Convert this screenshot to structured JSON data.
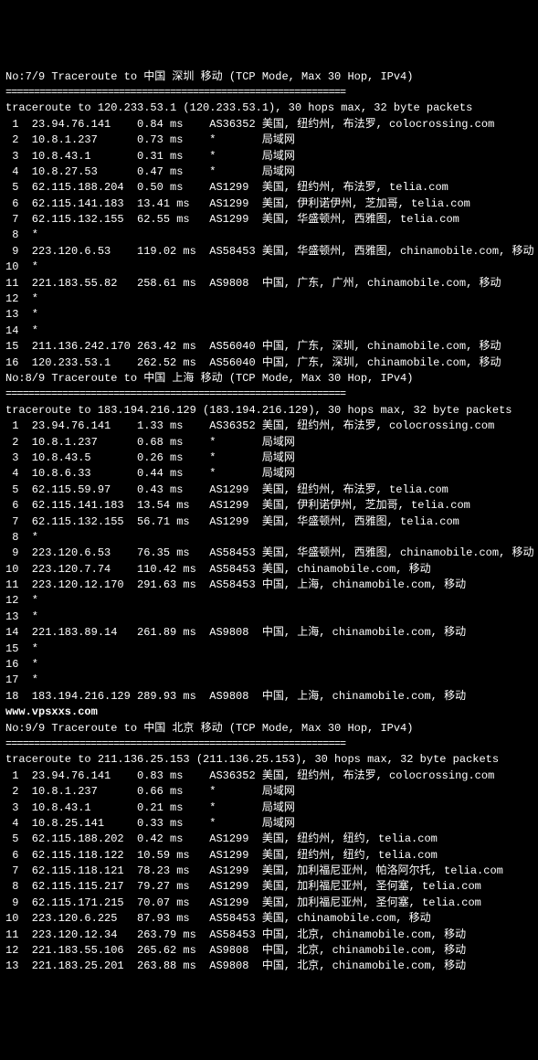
{
  "traces": [
    {
      "title": "No:7/9 Traceroute to 中国 深圳 移动 (TCP Mode, Max 30 Hop, IPv4)",
      "separator": "============================================================",
      "header": "traceroute to 120.233.53.1 (120.233.53.1), 30 hops max, 32 byte packets",
      "hops": [
        {
          "num": " 1",
          "ip": "23.94.76.141",
          "time": "0.84 ms",
          "asn": "AS36352",
          "loc": "美国, 纽约州, 布法罗, colocrossing.com"
        },
        {
          "num": " 2",
          "ip": "10.8.1.237",
          "time": "0.73 ms",
          "asn": "*",
          "loc": "局域网"
        },
        {
          "num": " 3",
          "ip": "10.8.43.1",
          "time": "0.31 ms",
          "asn": "*",
          "loc": "局域网"
        },
        {
          "num": " 4",
          "ip": "10.8.27.53",
          "time": "0.47 ms",
          "asn": "*",
          "loc": "局域网"
        },
        {
          "num": " 5",
          "ip": "62.115.188.204",
          "time": "0.50 ms",
          "asn": "AS1299",
          "loc": "美国, 纽约州, 布法罗, telia.com"
        },
        {
          "num": " 6",
          "ip": "62.115.141.183",
          "time": "13.41 ms",
          "asn": "AS1299",
          "loc": "美国, 伊利诺伊州, 芝加哥, telia.com"
        },
        {
          "num": " 7",
          "ip": "62.115.132.155",
          "time": "62.55 ms",
          "asn": "AS1299",
          "loc": "美国, 华盛顿州, 西雅图, telia.com"
        },
        {
          "num": " 8",
          "ip": "*",
          "time": "",
          "asn": "",
          "loc": ""
        },
        {
          "num": " 9",
          "ip": "223.120.6.53",
          "time": "119.02 ms",
          "asn": "AS58453",
          "loc": "美国, 华盛顿州, 西雅图, chinamobile.com, 移动"
        },
        {
          "num": "10",
          "ip": "*",
          "time": "",
          "asn": "",
          "loc": ""
        },
        {
          "num": "11",
          "ip": "221.183.55.82",
          "time": "258.61 ms",
          "asn": "AS9808",
          "loc": "中国, 广东, 广州, chinamobile.com, 移动"
        },
        {
          "num": "12",
          "ip": "*",
          "time": "",
          "asn": "",
          "loc": ""
        },
        {
          "num": "13",
          "ip": "*",
          "time": "",
          "asn": "",
          "loc": ""
        },
        {
          "num": "14",
          "ip": "*",
          "time": "",
          "asn": "",
          "loc": ""
        },
        {
          "num": "15",
          "ip": "211.136.242.170",
          "time": "263.42 ms",
          "asn": "AS56040",
          "loc": "中国, 广东, 深圳, chinamobile.com, 移动"
        },
        {
          "num": "16",
          "ip": "120.233.53.1",
          "time": "262.52 ms",
          "asn": "AS56040",
          "loc": "中国, 广东, 深圳, chinamobile.com, 移动"
        }
      ]
    },
    {
      "title": "No:8/9 Traceroute to 中国 上海 移动 (TCP Mode, Max 30 Hop, IPv4)",
      "separator": "============================================================",
      "header": "traceroute to 183.194.216.129 (183.194.216.129), 30 hops max, 32 byte packets",
      "hops": [
        {
          "num": " 1",
          "ip": "23.94.76.141",
          "time": "1.33 ms",
          "asn": "AS36352",
          "loc": "美国, 纽约州, 布法罗, colocrossing.com"
        },
        {
          "num": " 2",
          "ip": "10.8.1.237",
          "time": "0.68 ms",
          "asn": "*",
          "loc": "局域网"
        },
        {
          "num": " 3",
          "ip": "10.8.43.5",
          "time": "0.26 ms",
          "asn": "*",
          "loc": "局域网"
        },
        {
          "num": " 4",
          "ip": "10.8.6.33",
          "time": "0.44 ms",
          "asn": "*",
          "loc": "局域网"
        },
        {
          "num": " 5",
          "ip": "62.115.59.97",
          "time": "0.43 ms",
          "asn": "AS1299",
          "loc": "美国, 纽约州, 布法罗, telia.com"
        },
        {
          "num": " 6",
          "ip": "62.115.141.183",
          "time": "13.54 ms",
          "asn": "AS1299",
          "loc": "美国, 伊利诺伊州, 芝加哥, telia.com"
        },
        {
          "num": " 7",
          "ip": "62.115.132.155",
          "time": "56.71 ms",
          "asn": "AS1299",
          "loc": "美国, 华盛顿州, 西雅图, telia.com"
        },
        {
          "num": " 8",
          "ip": "*",
          "time": "",
          "asn": "",
          "loc": ""
        },
        {
          "num": " 9",
          "ip": "223.120.6.53",
          "time": "76.35 ms",
          "asn": "AS58453",
          "loc": "美国, 华盛顿州, 西雅图, chinamobile.com, 移动"
        },
        {
          "num": "10",
          "ip": "223.120.7.74",
          "time": "110.42 ms",
          "asn": "AS58453",
          "loc": "美国, chinamobile.com, 移动"
        },
        {
          "num": "11",
          "ip": "223.120.12.170",
          "time": "291.63 ms",
          "asn": "AS58453",
          "loc": "中国, 上海, chinamobile.com, 移动"
        },
        {
          "num": "12",
          "ip": "*",
          "time": "",
          "asn": "",
          "loc": ""
        },
        {
          "num": "13",
          "ip": "*",
          "time": "",
          "asn": "",
          "loc": ""
        },
        {
          "num": "14",
          "ip": "221.183.89.14",
          "time": "261.89 ms",
          "asn": "AS9808",
          "loc": "中国, 上海, chinamobile.com, 移动"
        },
        {
          "num": "15",
          "ip": "*",
          "time": "",
          "asn": "",
          "loc": ""
        },
        {
          "num": "16",
          "ip": "*",
          "time": "",
          "asn": "",
          "loc": ""
        },
        {
          "num": "17",
          "ip": "*",
          "time": "",
          "asn": "",
          "loc": ""
        },
        {
          "num": "18",
          "ip": "183.194.216.129",
          "time": "289.93 ms",
          "asn": "AS9808",
          "loc": "中国, 上海, chinamobile.com, 移动"
        }
      ]
    },
    {
      "title": "No:9/9 Traceroute to 中国 北京 移动 (TCP Mode, Max 30 Hop, IPv4)",
      "separator": "============================================================",
      "header": "traceroute to 211.136.25.153 (211.136.25.153), 30 hops max, 32 byte packets",
      "hops": [
        {
          "num": " 1",
          "ip": "23.94.76.141",
          "time": "0.83 ms",
          "asn": "AS36352",
          "loc": "美国, 纽约州, 布法罗, colocrossing.com"
        },
        {
          "num": " 2",
          "ip": "10.8.1.237",
          "time": "0.66 ms",
          "asn": "*",
          "loc": "局域网"
        },
        {
          "num": " 3",
          "ip": "10.8.43.1",
          "time": "0.21 ms",
          "asn": "*",
          "loc": "局域网"
        },
        {
          "num": " 4",
          "ip": "10.8.25.141",
          "time": "0.33 ms",
          "asn": "*",
          "loc": "局域网"
        },
        {
          "num": " 5",
          "ip": "62.115.188.202",
          "time": "0.42 ms",
          "asn": "AS1299",
          "loc": "美国, 纽约州, 纽约, telia.com"
        },
        {
          "num": " 6",
          "ip": "62.115.118.122",
          "time": "10.59 ms",
          "asn": "AS1299",
          "loc": "美国, 纽约州, 纽约, telia.com"
        },
        {
          "num": " 7",
          "ip": "62.115.118.121",
          "time": "78.23 ms",
          "asn": "AS1299",
          "loc": "美国, 加利福尼亚州, 帕洛阿尔托, telia.com"
        },
        {
          "num": " 8",
          "ip": "62.115.115.217",
          "time": "79.27 ms",
          "asn": "AS1299",
          "loc": "美国, 加利福尼亚州, 圣何塞, telia.com"
        },
        {
          "num": " 9",
          "ip": "62.115.171.215",
          "time": "70.07 ms",
          "asn": "AS1299",
          "loc": "美国, 加利福尼亚州, 圣何塞, telia.com"
        },
        {
          "num": "10",
          "ip": "223.120.6.225",
          "time": "87.93 ms",
          "asn": "AS58453",
          "loc": "美国, chinamobile.com, 移动"
        },
        {
          "num": "11",
          "ip": "223.120.12.34",
          "time": "263.79 ms",
          "asn": "AS58453",
          "loc": "中国, 北京, chinamobile.com, 移动"
        },
        {
          "num": "12",
          "ip": "221.183.55.106",
          "time": "265.62 ms",
          "asn": "AS9808",
          "loc": "中国, 北京, chinamobile.com, 移动"
        },
        {
          "num": "13",
          "ip": "221.183.25.201",
          "time": "263.88 ms",
          "asn": "AS9808",
          "loc": "中国, 北京, chinamobile.com, 移动"
        }
      ]
    }
  ],
  "watermark": "www.vpsxxs.com",
  "col_widths": {
    "num": 2,
    "ip": 16,
    "time": 11,
    "asn": 8
  }
}
